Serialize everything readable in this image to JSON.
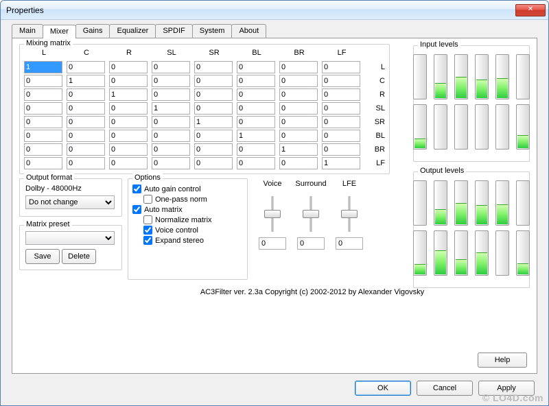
{
  "window": {
    "title": "Properties"
  },
  "tabs": [
    "Main",
    "Mixer",
    "Gains",
    "Equalizer",
    "SPDIF",
    "System",
    "About"
  ],
  "active_tab": "Mixer",
  "mixing_matrix": {
    "legend": "Mixing matrix",
    "cols": [
      "L",
      "C",
      "R",
      "SL",
      "SR",
      "BL",
      "BR",
      "LF"
    ],
    "rows": [
      "L",
      "C",
      "R",
      "SL",
      "SR",
      "BL",
      "BR",
      "LF"
    ],
    "cells": [
      [
        "1",
        "0",
        "0",
        "0",
        "0",
        "0",
        "0",
        "0"
      ],
      [
        "0",
        "1",
        "0",
        "0",
        "0",
        "0",
        "0",
        "0"
      ],
      [
        "0",
        "0",
        "1",
        "0",
        "0",
        "0",
        "0",
        "0"
      ],
      [
        "0",
        "0",
        "0",
        "1",
        "0",
        "0",
        "0",
        "0"
      ],
      [
        "0",
        "0",
        "0",
        "0",
        "1",
        "0",
        "0",
        "0"
      ],
      [
        "0",
        "0",
        "0",
        "0",
        "0",
        "1",
        "0",
        "0"
      ],
      [
        "0",
        "0",
        "0",
        "0",
        "0",
        "0",
        "1",
        "0"
      ],
      [
        "0",
        "0",
        "0",
        "0",
        "0",
        "0",
        "0",
        "1"
      ]
    ]
  },
  "output_format": {
    "legend": "Output format",
    "status": "Dolby - 48000Hz",
    "selected": "Do not change"
  },
  "matrix_preset": {
    "legend": "Matrix preset",
    "value": "",
    "save": "Save",
    "delete": "Delete"
  },
  "options": {
    "legend": "Options",
    "auto_gain": {
      "label": "Auto gain control",
      "checked": true
    },
    "one_pass": {
      "label": "One-pass norm",
      "checked": false
    },
    "auto_matrix": {
      "label": "Auto matrix",
      "checked": true
    },
    "normalize": {
      "label": "Normalize matrix",
      "checked": false
    },
    "voice_ctrl": {
      "label": "Voice control",
      "checked": true
    },
    "expand_stereo": {
      "label": "Expand stereo",
      "checked": true
    }
  },
  "sliders": {
    "voice": {
      "label": "Voice",
      "value": "0"
    },
    "surround": {
      "label": "Surround",
      "value": "0"
    },
    "lfe": {
      "label": "LFE",
      "value": "0"
    }
  },
  "input_levels": {
    "legend": "Input levels",
    "bars": [
      0,
      35,
      48,
      42,
      45,
      0,
      22,
      0,
      0,
      0,
      0,
      30
    ]
  },
  "output_levels": {
    "legend": "Output levels",
    "bars": [
      0,
      35,
      48,
      44,
      45,
      0,
      24,
      55,
      35,
      50,
      0,
      25
    ]
  },
  "copyright": "AC3Filter ver. 2.3a Copyright (c) 2002-2012 by Alexander Vigovsky",
  "buttons": {
    "help": "Help",
    "ok": "OK",
    "cancel": "Cancel",
    "apply": "Apply"
  },
  "watermark": "© LO4D.com"
}
